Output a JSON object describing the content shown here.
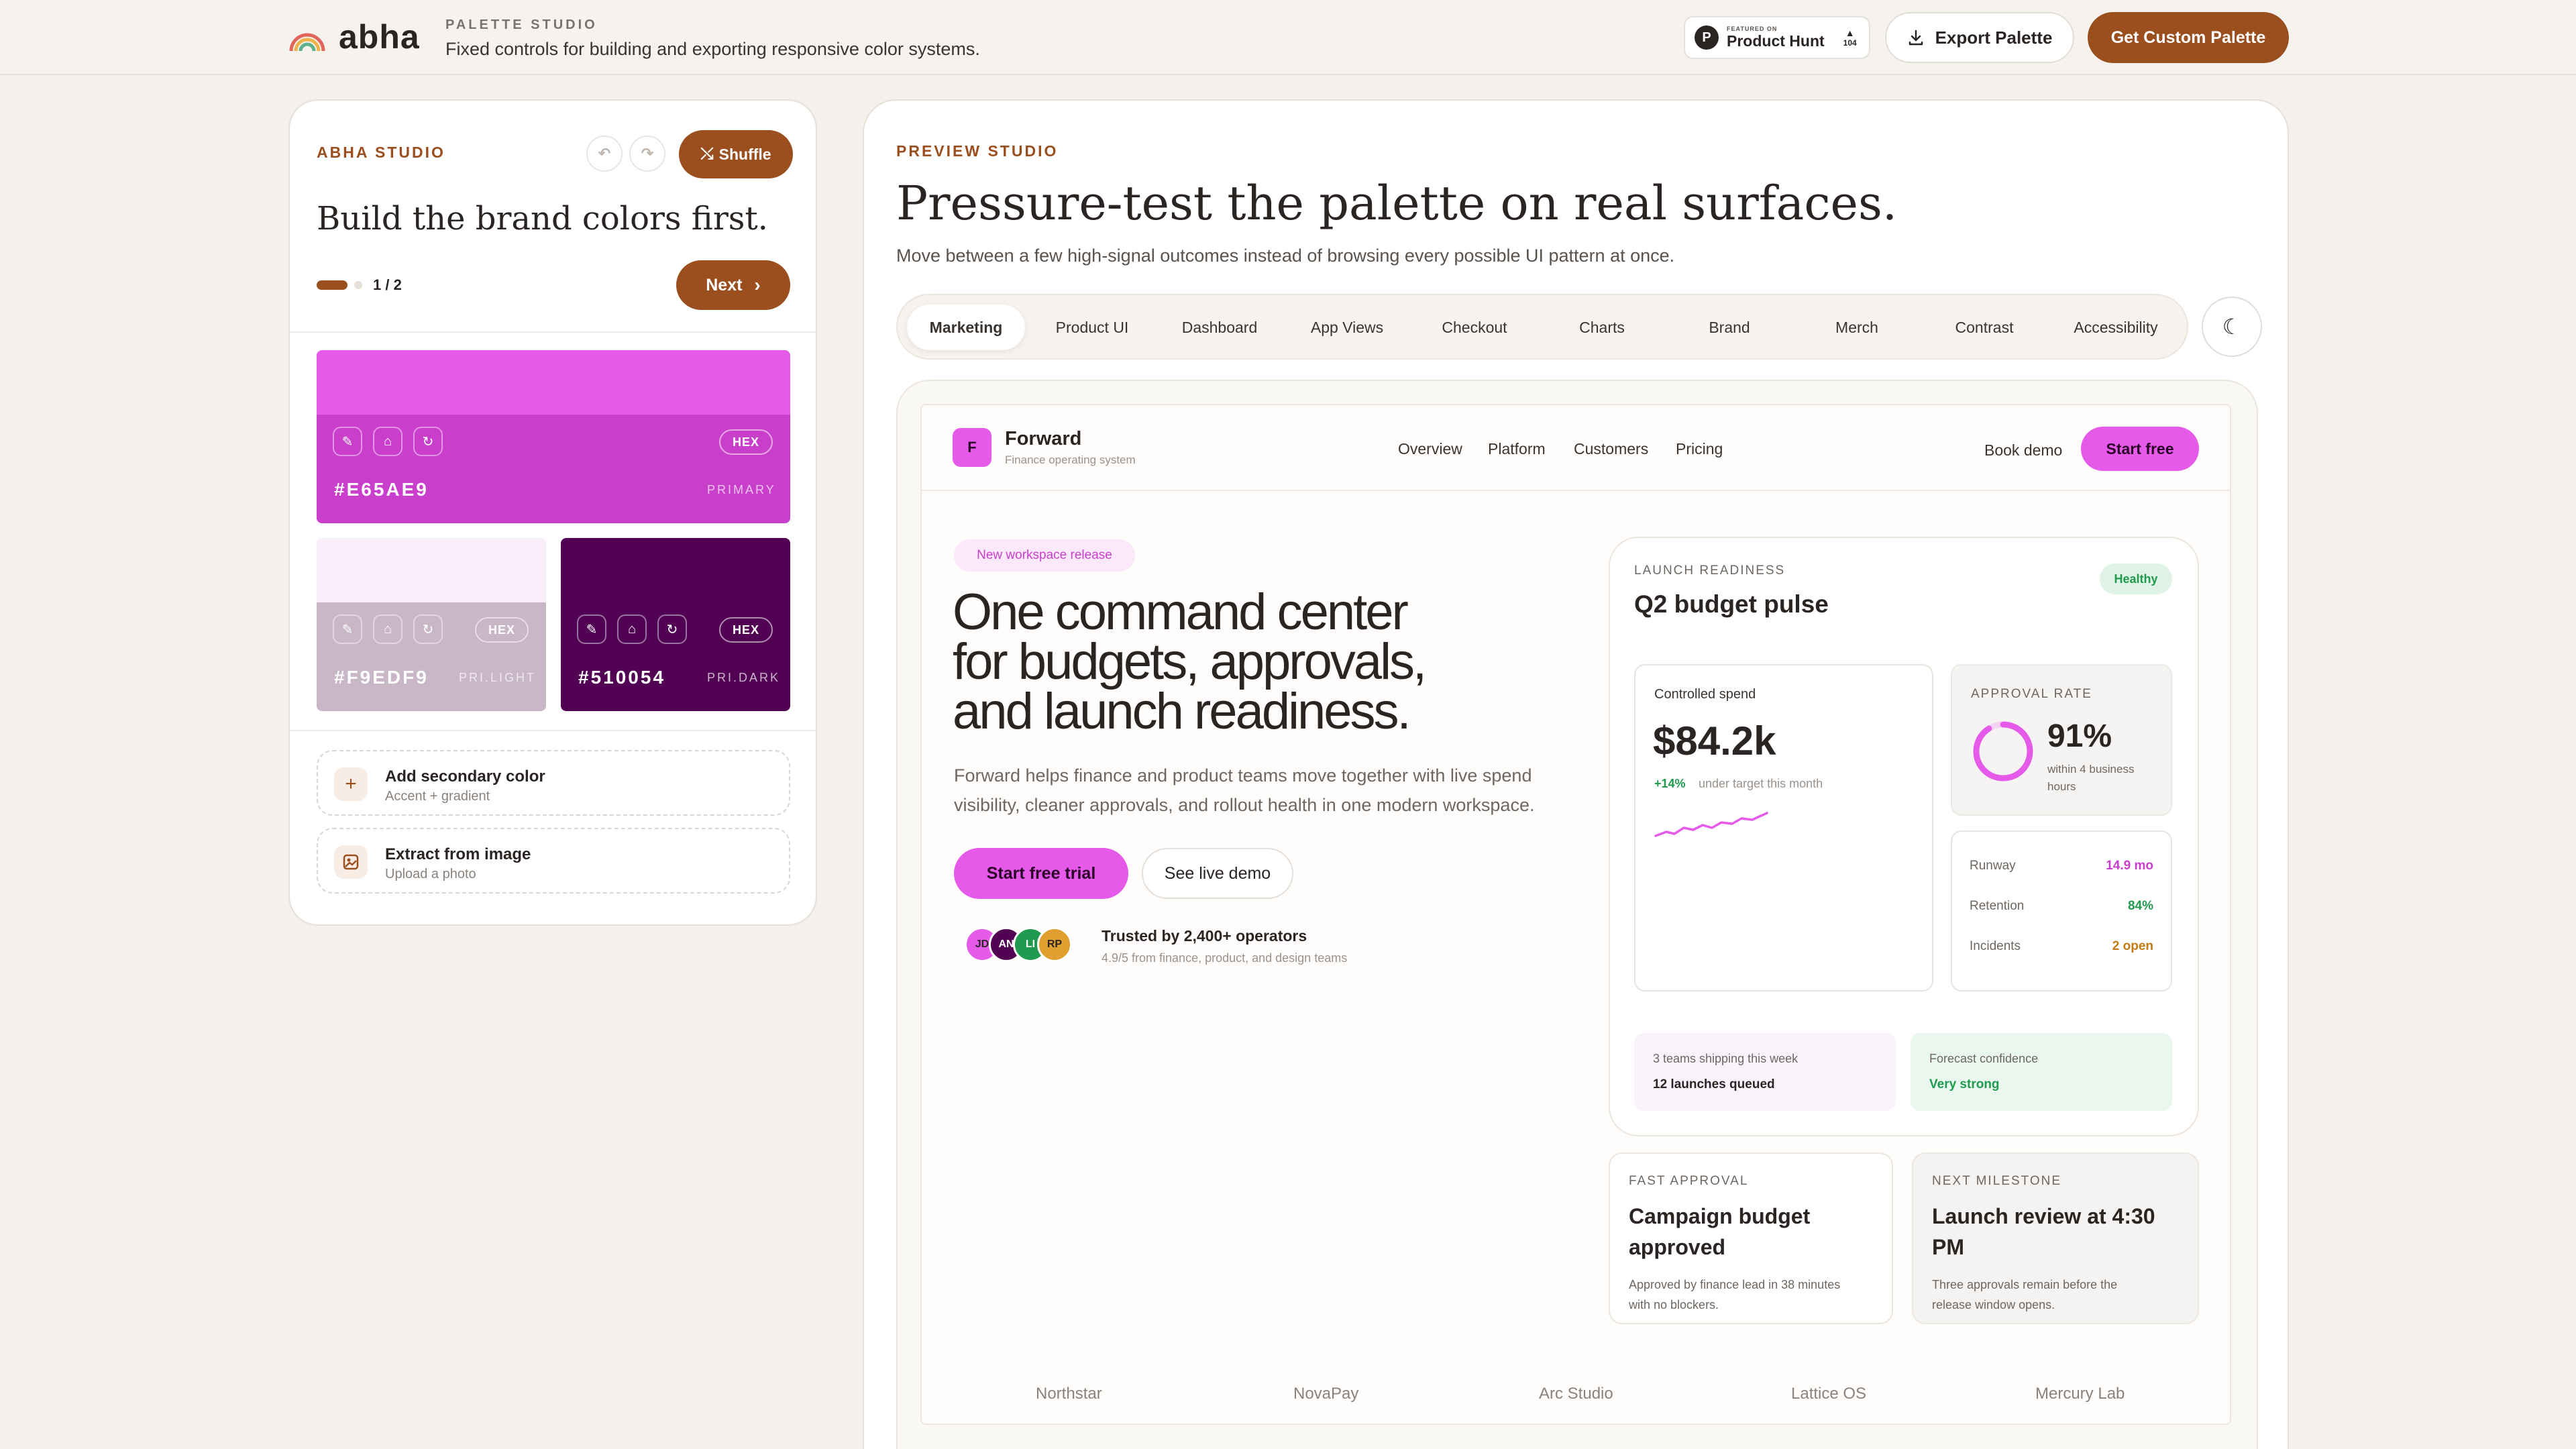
{
  "app": {
    "name": "abha",
    "kicker": "PALETTE STUDIO",
    "subtitle": "Fixed controls for building and exporting responsive color systems."
  },
  "header": {
    "producthunt_featured": "FEATURED ON",
    "producthunt_name": "Product Hunt",
    "producthunt_votes": "104",
    "export_label": "Export Palette",
    "custom_label": "Get Custom Palette"
  },
  "studio": {
    "kicker": "ABHA STUDIO",
    "shuffle_label": "Shuffle",
    "title": "Build the brand colors first.",
    "step": "1 / 2",
    "next_label": "Next",
    "swatches": {
      "primary": {
        "hex": "#E65AE9",
        "label": "PRIMARY",
        "format": "HEX",
        "color": "#E65AE9"
      },
      "light": {
        "hex": "#F9EDF9",
        "label": "PRI.LIGHT",
        "format": "HEX",
        "color": "#F9EDF9"
      },
      "dark": {
        "hex": "#510054",
        "label": "PRI.DARK",
        "format": "HEX",
        "color": "#510054"
      }
    },
    "options": [
      {
        "title": "Add secondary color",
        "sub": "Accent + gradient"
      },
      {
        "title": "Extract from image",
        "sub": "Upload a photo"
      }
    ]
  },
  "preview": {
    "kicker": "PREVIEW STUDIO",
    "title": "Pressure-test the palette on real surfaces.",
    "desc": "Move between a few high-signal outcomes instead of browsing every possible UI pattern at once.",
    "tabs": [
      "Marketing",
      "Product UI",
      "Dashboard",
      "App Views",
      "Checkout",
      "Charts",
      "Brand",
      "Merch",
      "Contrast",
      "Accessibility"
    ]
  },
  "site": {
    "logo_letter": "F",
    "brand": "Forward",
    "brand_sub": "Finance operating system",
    "nav": [
      "Overview",
      "Platform",
      "Customers",
      "Pricing"
    ],
    "book_demo": "Book demo",
    "start_free": "Start free",
    "badge": "New workspace release",
    "hero_lines": [
      "One command center",
      "for budgets, approvals,",
      "and launch readiness."
    ],
    "hero_desc_lines": [
      "Forward helps finance and product teams move together with live spend",
      "visibility, cleaner approvals, and rollout health in one modern workspace."
    ],
    "cta_primary": "Start free trial",
    "cta_secondary": "See live demo",
    "avatars": [
      "JD",
      "AN",
      "LI",
      "RP"
    ],
    "trusted": "Trusted by 2,400+ operators",
    "trusted_sub": "4.9/5 from finance, product, and design teams",
    "logos": [
      "Northstar",
      "NovaPay",
      "Arc Studio",
      "Lattice OS",
      "Mercury Lab"
    ]
  },
  "dashboard": {
    "kicker": "LAUNCH READINESS",
    "title": "Q2 budget pulse",
    "status": "Healthy",
    "spend_label": "Controlled spend",
    "spend_value": "$84.2k",
    "spend_delta": "+14%",
    "spend_note": "under target this month",
    "approval_kicker": "APPROVAL RATE",
    "approval_value": "91%",
    "approval_percent": 91,
    "approval_note_lines": [
      "within 4 business",
      "hours"
    ],
    "stats": [
      {
        "label": "Runway",
        "value": "14.9 mo",
        "color": "#c93fcc"
      },
      {
        "label": "Retention",
        "value": "84%",
        "color": "#1f9a4e"
      },
      {
        "label": "Incidents",
        "value": "2 open",
        "color": "#c27a12"
      }
    ],
    "teams_label": "3 teams shipping this week",
    "teams_value": "12 launches queued",
    "forecast_label": "Forecast confidence",
    "forecast_value": "Very strong"
  },
  "cards": [
    {
      "kicker": "FAST APPROVAL",
      "title_lines": [
        "Campaign budget",
        "approved"
      ],
      "desc_lines": [
        "Approved by finance lead in 38 minutes",
        "with no blockers."
      ]
    },
    {
      "kicker": "NEXT MILESTONE",
      "title_lines": [
        "Launch review at 4:30",
        "PM"
      ],
      "desc_lines": [
        "Three approvals remain before the",
        "release window opens."
      ]
    }
  ]
}
